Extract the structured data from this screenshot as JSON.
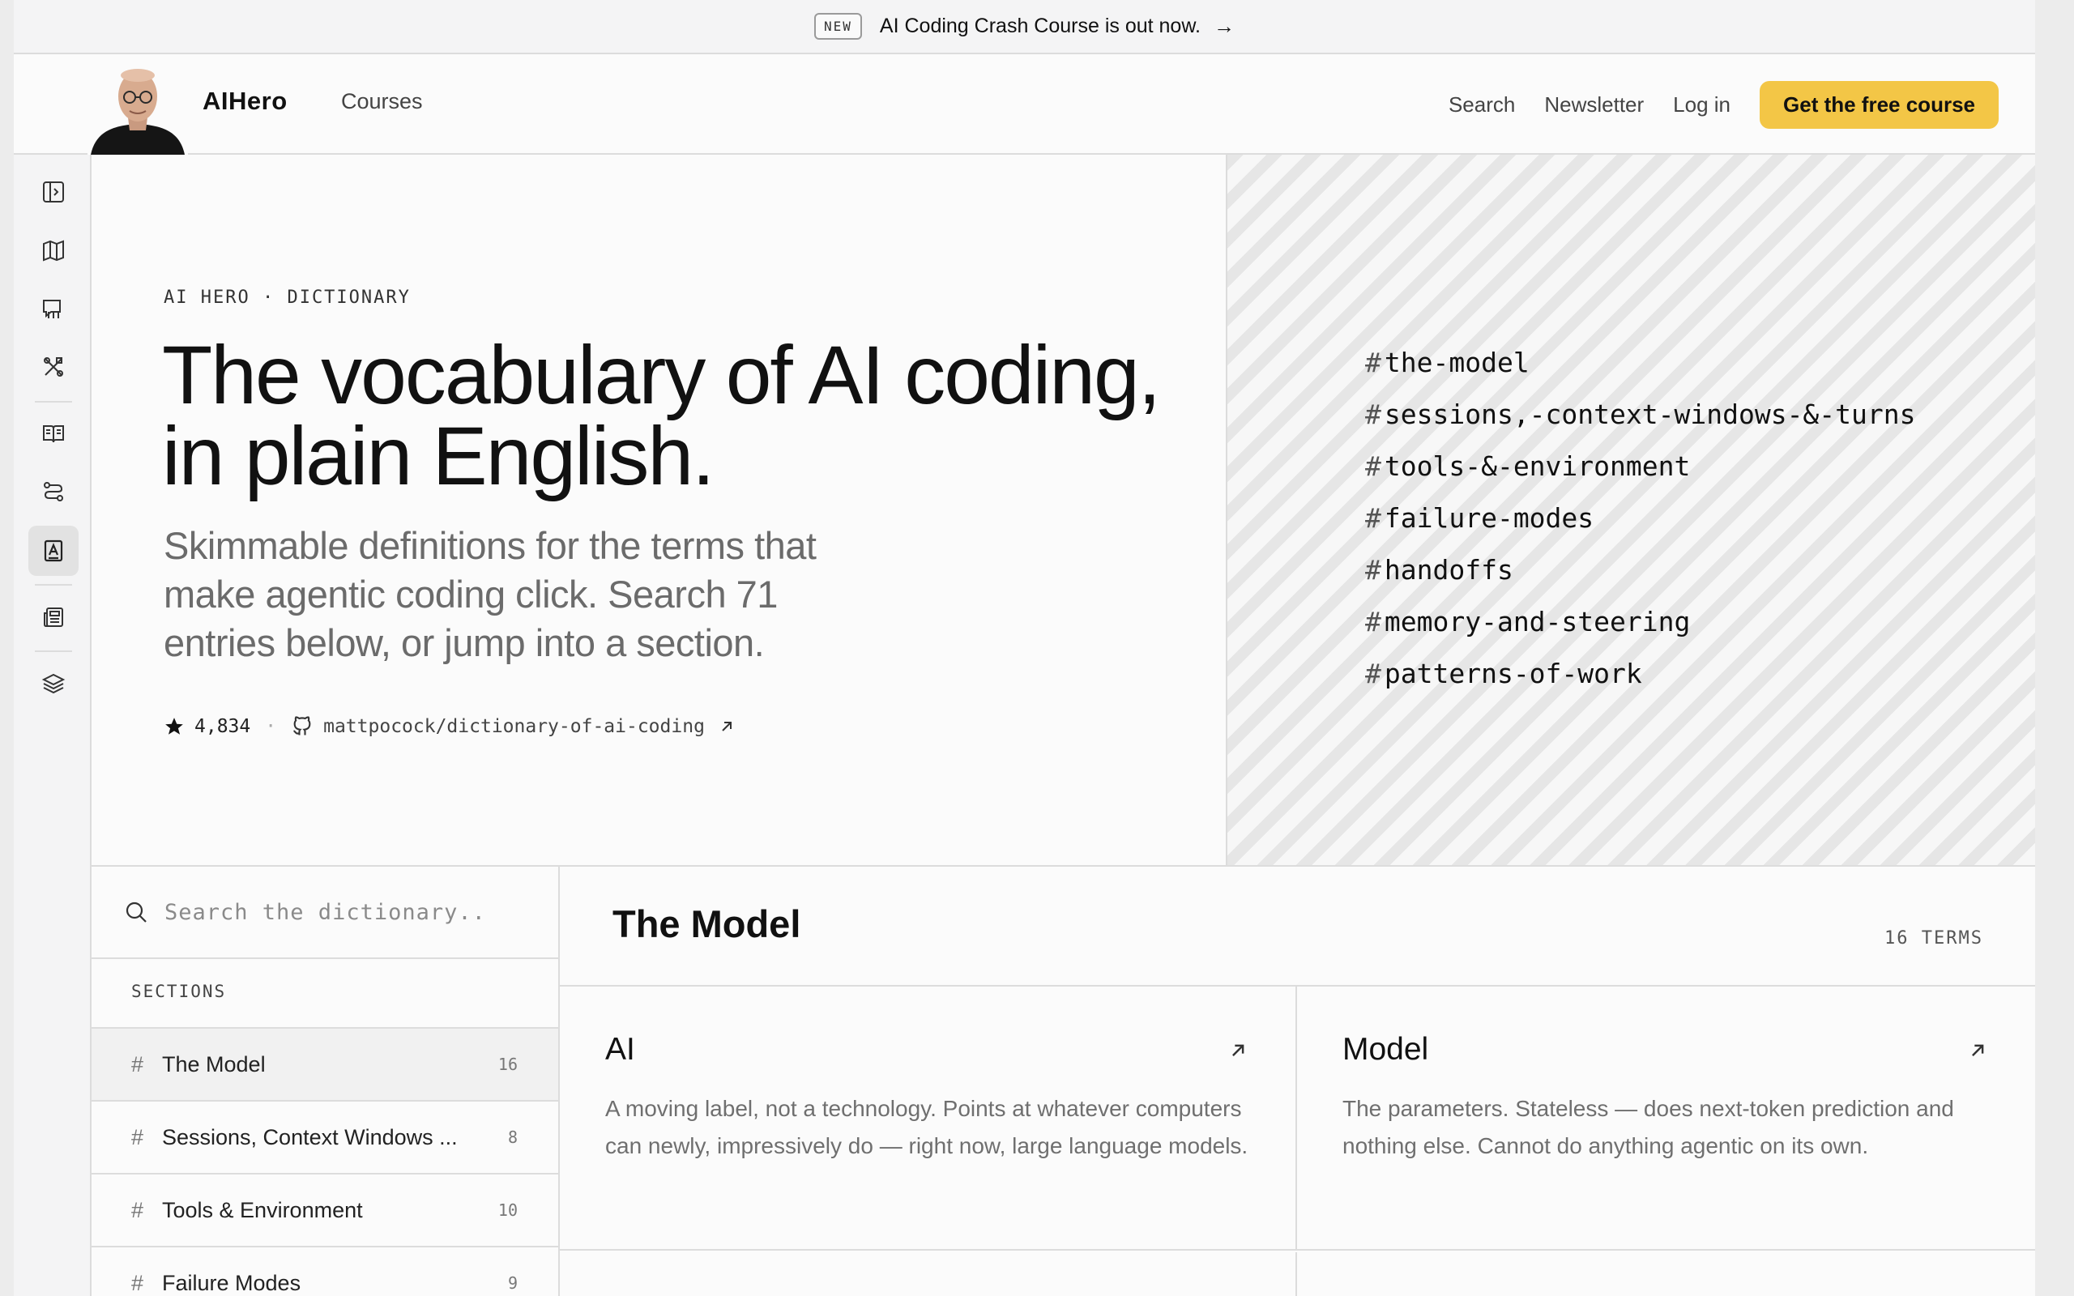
{
  "announcement": {
    "badge": "NEW",
    "message": "AI Coding Crash Course is out now.",
    "arrow": "→"
  },
  "header": {
    "brand": "AIHero",
    "nav_courses": "Courses",
    "search": "Search",
    "newsletter": "Newsletter",
    "login": "Log in",
    "cta": "Get the free course"
  },
  "rail": {
    "icons": [
      "panel-expand-icon",
      "map-icon",
      "chat-bubbles-icon",
      "tools-icon",
      "book-open-icon",
      "workflow-icon",
      "dictionary-icon",
      "newspaper-icon",
      "layers-icon"
    ],
    "active": "dictionary-icon"
  },
  "hero": {
    "eyebrow": "AI HERO · DICTIONARY",
    "title_line1": "The vocabulary of AI coding,",
    "title_line2": "in plain English.",
    "subtitle": "Skimmable definitions for the terms that make agentic coding click. Search 71 entries below, or jump into a section.",
    "stars": "4,834",
    "separator": "·",
    "repo": "mattpocock/dictionary-of-ai-coding"
  },
  "tags": [
    "the-model",
    "sessions,-context-windows-&-turns",
    "tools-&-environment",
    "failure-modes",
    "handoffs",
    "memory-and-steering",
    "patterns-of-work"
  ],
  "sidebar": {
    "search_placeholder": "Search the dictionary..",
    "sections_label": "SECTIONS",
    "items": [
      {
        "label": "The Model",
        "count": "16"
      },
      {
        "label": "Sessions, Context Windows ...",
        "count": "8"
      },
      {
        "label": "Tools & Environment",
        "count": "10"
      },
      {
        "label": "Failure Modes",
        "count": "9"
      }
    ]
  },
  "main": {
    "title": "The Model",
    "term_count": "16 TERMS",
    "cards": [
      {
        "title": "AI",
        "desc": "A moving label, not a technology. Points at whatever computers can newly, impressively do — right now, large language models."
      },
      {
        "title": "Model",
        "desc": "The parameters. Stateless — does next-token prediction and nothing else. Cannot do anything agentic on its own."
      }
    ]
  },
  "colors": {
    "accent": "#f3c646",
    "background": "#fbfbfb",
    "border": "#dcdcdc"
  }
}
